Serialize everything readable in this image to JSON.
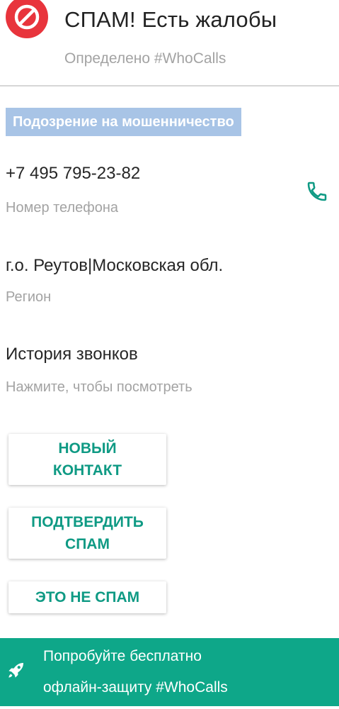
{
  "header": {
    "title": "СПАМ! Есть жалобы",
    "subtitle": "Определено #WhoCalls",
    "icon": "no-entry-icon",
    "icon_color": "#e8343c"
  },
  "badge": {
    "label": "Подозрение на мошенничество",
    "color": "#a8c4e6"
  },
  "phone": {
    "value": "+7 495 795-23-82",
    "label": "Номер телефона",
    "icon": "phone-icon"
  },
  "region": {
    "value": "г.о. Реутов|Московская обл.",
    "label": "Регион"
  },
  "history": {
    "title": "История звонков",
    "hint": "Нажмите, чтобы посмотреть"
  },
  "buttons": {
    "new_contact_line1": "НОВЫЙ",
    "new_contact_line2": "КОНТАКТ",
    "confirm_spam_line1": "ПОДТВЕРДИТЬ",
    "confirm_spam_line2": "СПАМ",
    "not_spam": "ЭТО НЕ СПАМ"
  },
  "promo": {
    "line1": "Попробуйте бесплатно",
    "line2": "офлайн-защиту #WhoCalls",
    "icon": "rocket-icon",
    "color": "#0ea789"
  },
  "accent_color": "#0f9a84"
}
